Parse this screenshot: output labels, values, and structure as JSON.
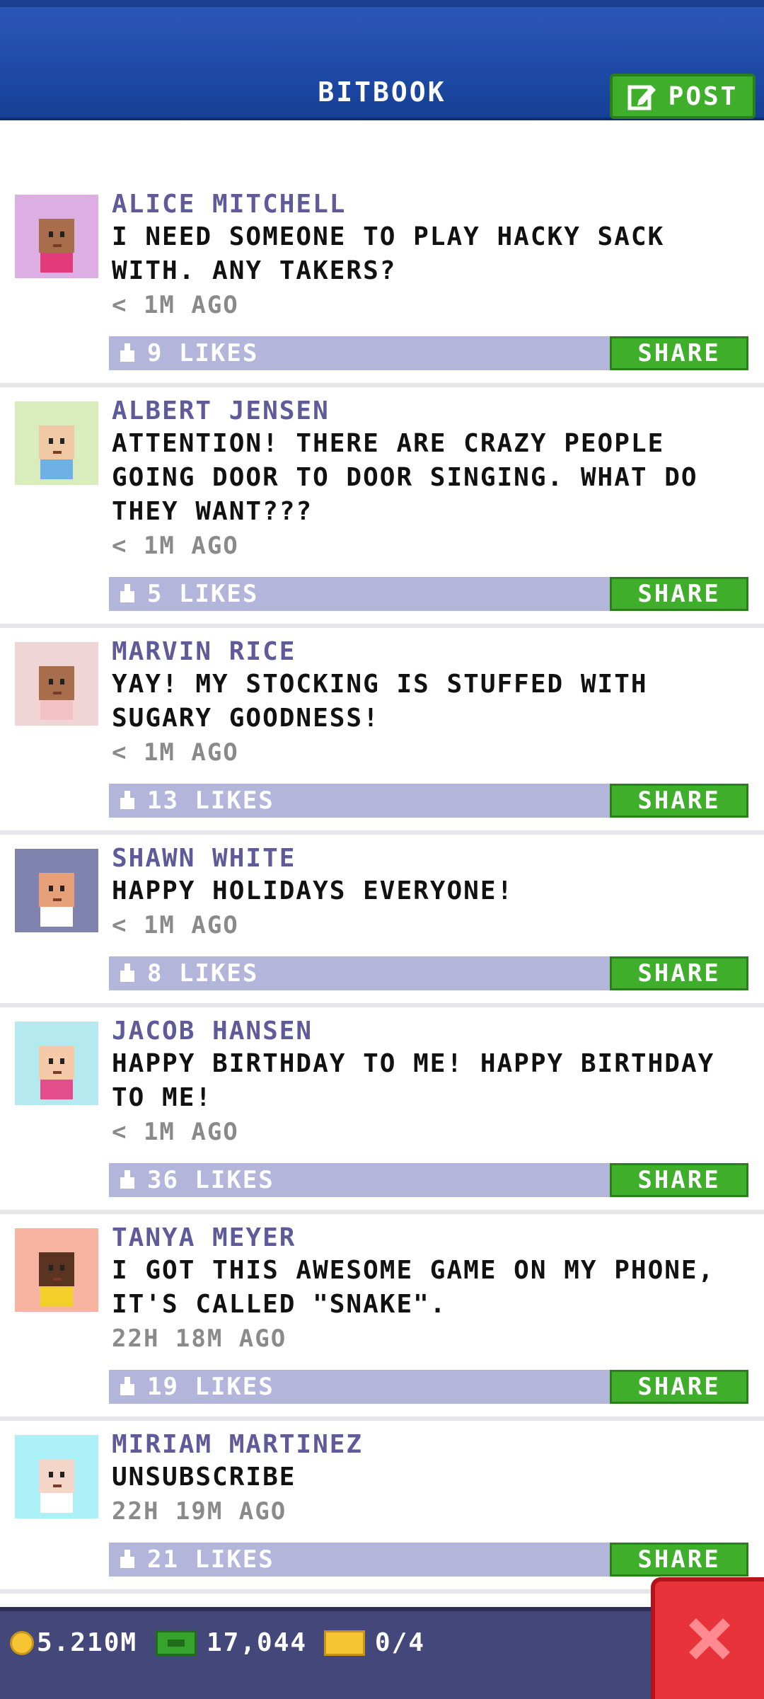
{
  "header": {
    "title": "BITBOOK",
    "post_label": "POST"
  },
  "posts": [
    {
      "name": "ALICE MITCHELL",
      "message": "I NEED SOMEONE TO PLAY HACKY SACK WITH. ANY TAKERS?",
      "time": "< 1M AGO",
      "likes": "9 LIKES",
      "share": "SHARE",
      "avatar_bg": "#dcaee2",
      "skin": "#a86d4b",
      "shirt": "#e23b7a"
    },
    {
      "name": "ALBERT JENSEN",
      "message": "ATTENTION! THERE ARE CRAZY PEOPLE GOING DOOR TO DOOR SINGING. WHAT DO THEY WANT???",
      "time": "< 1M AGO",
      "likes": "5 LIKES",
      "share": "SHARE",
      "avatar_bg": "#d9ecbb",
      "skin": "#f1c8a4",
      "shirt": "#6fb0e6"
    },
    {
      "name": "MARVIN RICE",
      "message": "YAY! MY STOCKING IS STUFFED WITH SUGARY GOODNESS!",
      "time": "< 1M AGO",
      "likes": "13 LIKES",
      "share": "SHARE",
      "avatar_bg": "#efd5d6",
      "skin": "#a86d4b",
      "shirt": "#f3c2c6"
    },
    {
      "name": "SHAWN WHITE",
      "message": "HAPPY HOLIDAYS EVERYONE!",
      "time": "< 1M AGO",
      "likes": "8 LIKES",
      "share": "SHARE",
      "avatar_bg": "#7f83ad",
      "skin": "#e6a17a",
      "shirt": "#ffffff"
    },
    {
      "name": "JACOB HANSEN",
      "message": "HAPPY BIRTHDAY TO ME! HAPPY BIRTHDAY TO ME!",
      "time": "< 1M AGO",
      "likes": "36 LIKES",
      "share": "SHARE",
      "avatar_bg": "#b4e9ef",
      "skin": "#f6c9a8",
      "shirt": "#e24d8a"
    },
    {
      "name": "TANYA MEYER",
      "message": "I GOT THIS AWESOME GAME ON MY PHONE, IT'S CALLED \"SNAKE\".",
      "time": "22H 18M AGO",
      "likes": "19 LIKES",
      "share": "SHARE",
      "avatar_bg": "#f7b4a1",
      "skin": "#5a3420",
      "shirt": "#f3cf2a"
    },
    {
      "name": "MIRIAM MARTINEZ",
      "message": "UNSUBSCRIBE",
      "time": "22H 19M AGO",
      "likes": "21 LIKES",
      "share": "SHARE",
      "avatar_bg": "#aef0f7",
      "skin": "#f4d6c8",
      "shirt": "#ffffff"
    }
  ],
  "status": {
    "coins": "5.210M",
    "bux": "17,044",
    "tickets": "0/4"
  },
  "colors": {
    "accent_green": "#3fae2a",
    "header_blue": "#1e4aa6",
    "likes_bar": "#b3b5db",
    "close_red": "#e8333a"
  }
}
